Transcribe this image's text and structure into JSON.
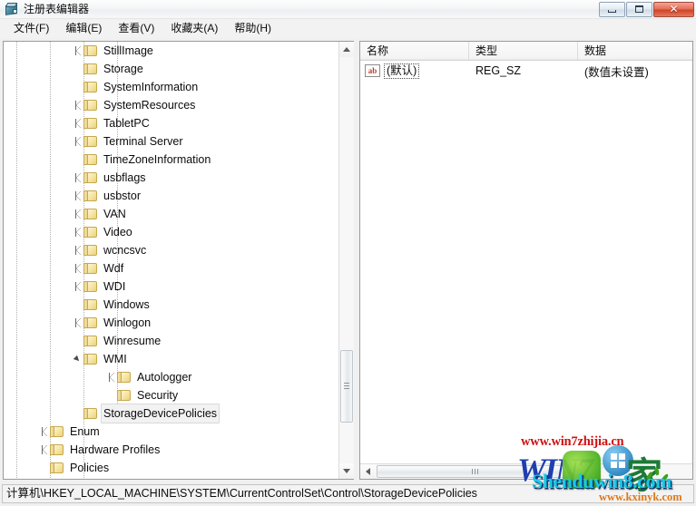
{
  "window": {
    "title": "注册表编辑器",
    "icon": "registry-editor-icon",
    "controls": {
      "minimize": "最小化",
      "maximize": "最大化",
      "close": "✕"
    }
  },
  "menu": {
    "items": [
      {
        "label": "文件(F)"
      },
      {
        "label": "编辑(E)"
      },
      {
        "label": "查看(V)"
      },
      {
        "label": "收藏夹(A)"
      },
      {
        "label": "帮助(H)"
      }
    ]
  },
  "tree": {
    "items": [
      {
        "label": "StillImage",
        "depth": 3,
        "arrow": "collapsed"
      },
      {
        "label": "Storage",
        "depth": 3,
        "arrow": "none"
      },
      {
        "label": "SystemInformation",
        "depth": 3,
        "arrow": "none"
      },
      {
        "label": "SystemResources",
        "depth": 3,
        "arrow": "collapsed"
      },
      {
        "label": "TabletPC",
        "depth": 3,
        "arrow": "collapsed"
      },
      {
        "label": "Terminal Server",
        "depth": 3,
        "arrow": "collapsed"
      },
      {
        "label": "TimeZoneInformation",
        "depth": 3,
        "arrow": "none"
      },
      {
        "label": "usbflags",
        "depth": 3,
        "arrow": "collapsed"
      },
      {
        "label": "usbstor",
        "depth": 3,
        "arrow": "collapsed"
      },
      {
        "label": "VAN",
        "depth": 3,
        "arrow": "collapsed"
      },
      {
        "label": "Video",
        "depth": 3,
        "arrow": "collapsed"
      },
      {
        "label": "wcncsvc",
        "depth": 3,
        "arrow": "collapsed"
      },
      {
        "label": "Wdf",
        "depth": 3,
        "arrow": "collapsed"
      },
      {
        "label": "WDI",
        "depth": 3,
        "arrow": "collapsed"
      },
      {
        "label": "Windows",
        "depth": 3,
        "arrow": "none"
      },
      {
        "label": "Winlogon",
        "depth": 3,
        "arrow": "collapsed"
      },
      {
        "label": "Winresume",
        "depth": 3,
        "arrow": "none"
      },
      {
        "label": "WMI",
        "depth": 3,
        "arrow": "expanded"
      },
      {
        "label": "Autologger",
        "depth": 4,
        "arrow": "collapsed"
      },
      {
        "label": "Security",
        "depth": 4,
        "arrow": "none"
      },
      {
        "label": "StorageDevicePolicies",
        "depth": 3,
        "arrow": "none",
        "selected": true
      },
      {
        "label": "Enum",
        "depth": 2,
        "arrow": "collapsed"
      },
      {
        "label": "Hardware Profiles",
        "depth": 2,
        "arrow": "collapsed"
      },
      {
        "label": "Policies",
        "depth": 2,
        "arrow": "none"
      }
    ],
    "scrollbar": {
      "up": "▲",
      "down": "▼"
    }
  },
  "list": {
    "columns": [
      {
        "label": "名称"
      },
      {
        "label": "类型"
      },
      {
        "label": "数据"
      }
    ],
    "rows": [
      {
        "icon": "ab-string-icon",
        "icon_text": "ab",
        "name": "(默认)",
        "type": "REG_SZ",
        "data": "(数值未设置)"
      }
    ],
    "hscroll": {
      "left": "◄"
    }
  },
  "status": {
    "path": "计算机\\HKEY_LOCAL_MACHINE\\SYSTEM\\CurrentControlSet\\Control\\StorageDevicePolicies"
  },
  "watermarks": {
    "win7zhijia": "www.win7zhijia.cn",
    "win7_logo": "WIN7",
    "jia": "家",
    "shenduwin8": "Shenduwin8.com",
    "kxinyk": "www.kxinyk.com"
  },
  "colors": {
    "close_button": "#cf4526",
    "folder": "#f6e5a3",
    "watermark_red": "#d01010",
    "watermark_cyan": "#18c8e8",
    "watermark_blue": "#1f3fae",
    "watermark_green": "#1d7a36",
    "watermark_orange": "#e07818"
  }
}
